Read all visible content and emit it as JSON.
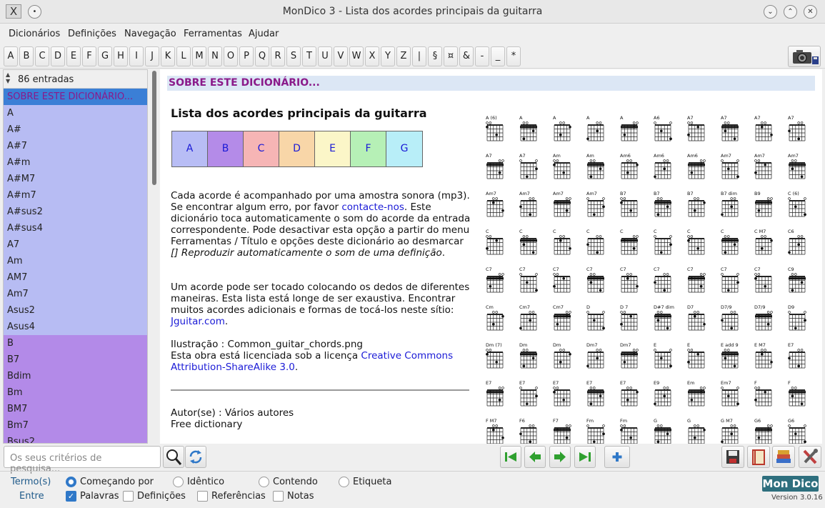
{
  "window": {
    "title": "MonDico 3 - Lista dos acordes principais da guitarra",
    "app_icon": "X"
  },
  "menu": [
    "Dicionários",
    "Definições",
    "Navegação",
    "Ferramentas",
    "Ajudar"
  ],
  "alphabet": [
    "A",
    "B",
    "C",
    "D",
    "E",
    "F",
    "G",
    "H",
    "I",
    "J",
    "K",
    "L",
    "M",
    "N",
    "O",
    "P",
    "Q",
    "R",
    "S",
    "T",
    "U",
    "V",
    "W",
    "X",
    "Y",
    "Z",
    "|",
    "§",
    "¤",
    "&",
    "-",
    "_",
    "*"
  ],
  "sidebar": {
    "count": "86 entradas",
    "items": [
      {
        "label": "SOBRE ESTE DICIONÁRIO...",
        "state": "selected"
      },
      {
        "label": "A",
        "state": "a"
      },
      {
        "label": "A#",
        "state": "a"
      },
      {
        "label": "A#7",
        "state": "a"
      },
      {
        "label": "A#m",
        "state": "a"
      },
      {
        "label": "A#M7",
        "state": "a"
      },
      {
        "label": "A#m7",
        "state": "a"
      },
      {
        "label": "A#sus2",
        "state": "a"
      },
      {
        "label": "A#sus4",
        "state": "a"
      },
      {
        "label": "A7",
        "state": "a"
      },
      {
        "label": "Am",
        "state": "a"
      },
      {
        "label": "AM7",
        "state": "a"
      },
      {
        "label": "Am7",
        "state": "a"
      },
      {
        "label": "Asus2",
        "state": "a"
      },
      {
        "label": "Asus4",
        "state": "a"
      },
      {
        "label": "B",
        "state": "b"
      },
      {
        "label": "B7",
        "state": "b"
      },
      {
        "label": "Bdim",
        "state": "b"
      },
      {
        "label": "Bm",
        "state": "b"
      },
      {
        "label": "BM7",
        "state": "b"
      },
      {
        "label": "Bm7",
        "state": "b"
      },
      {
        "label": "Bsus2",
        "state": "b"
      }
    ]
  },
  "content": {
    "header": "SOBRE ESTE DICIONÁRIO...",
    "title": "Lista dos acordes principais da guitarra",
    "keys": [
      {
        "label": "A",
        "color": "#b8bdf5"
      },
      {
        "label": "B",
        "color": "#b48be8"
      },
      {
        "label": "C",
        "color": "#f6b5b5"
      },
      {
        "label": "D",
        "color": "#f8d6a8"
      },
      {
        "label": "E",
        "color": "#fbf6c8"
      },
      {
        "label": "F",
        "color": "#b6f0b6"
      },
      {
        "label": "G",
        "color": "#b8eef8"
      }
    ],
    "para1_a": "Cada acorde é acompanhado por uma amostra sonora (mp3). Se encontrar algum erro, por favor ",
    "para1_link": "contacte-nos",
    "para1_b": ". Este dicionário toca automaticamente o som do acorde da entrada correspondente. Pode desactivar esta opção a partir do menu Ferramentas / Título e opções deste dicionário ao desmarcar ",
    "para1_em": "[] Reproduzir automaticamente o som de uma definição",
    "para1_c": ".",
    "para2_a": "Um acorde pode ser tocado colocando os dedos de diferentes maneiras. Esta lista está longe de ser exaustiva. Encontrar muitos acordes adicionais e formas de tocá-los neste sítio: ",
    "para2_link": "Jguitar.com",
    "para2_b": ".",
    "para3_a": "Ilustração : Common_guitar_chords.png",
    "para3_b": "Esta obra está licenciada sob a licença ",
    "para3_link": "Creative Commons Attribution-ShareAlike 3.0",
    "para3_c": ".",
    "author": "Autor(se) : Vários autores",
    "license": "Free dictionary",
    "chords": [
      [
        "A (6)",
        "A",
        "A",
        "A",
        "A",
        "A6",
        "A7",
        "A7",
        "A7",
        "A7"
      ],
      [
        "A7",
        "A7",
        "Am",
        "Am",
        "Am6",
        "Am6",
        "Am6",
        "Am7",
        "Am7",
        "Am7"
      ],
      [
        "Am7",
        "Am7",
        "Am7",
        "Am7",
        "B7",
        "B7",
        "B7",
        "B7 dim",
        "B9",
        "C (6)"
      ],
      [
        "C",
        "C",
        "C",
        "C",
        "C",
        "C",
        "C",
        "C",
        "C M7",
        "C6"
      ],
      [
        "C7",
        "C7",
        "C7",
        "C7",
        "C7",
        "C7",
        "C7",
        "C7",
        "C7",
        "C9"
      ],
      [
        "Cm",
        "Cm7",
        "Cm7",
        "D",
        "D 7",
        "D#7 dim",
        "D7",
        "D7/9",
        "D7/9",
        "D9"
      ],
      [
        "Dm (7)",
        "Dm",
        "Dm",
        "Dm7",
        "Dm7",
        "E",
        "E",
        "E add 9",
        "E M7",
        "E7"
      ],
      [
        "E7",
        "E7",
        "E7",
        "E7",
        "E7",
        "E9",
        "Em",
        "Em7",
        "F",
        "F"
      ],
      [
        "F M7",
        "F6",
        "F7",
        "Fm",
        "Fm",
        "G",
        "G",
        "G M7",
        "G6",
        "G6"
      ]
    ]
  },
  "search": {
    "placeholder": "Os seus critérios de pesquisa..."
  },
  "options": {
    "terms_label": "Termo(s)",
    "between_label": "Entre",
    "radios": [
      "Começando por",
      "Idêntico",
      "Contendo",
      "Etiqueta"
    ],
    "checks": [
      "Palavras",
      "Definições",
      "Referências",
      "Notas"
    ]
  },
  "brand": {
    "logo": "Mon Dico",
    "version": "Version 3.0.16"
  }
}
